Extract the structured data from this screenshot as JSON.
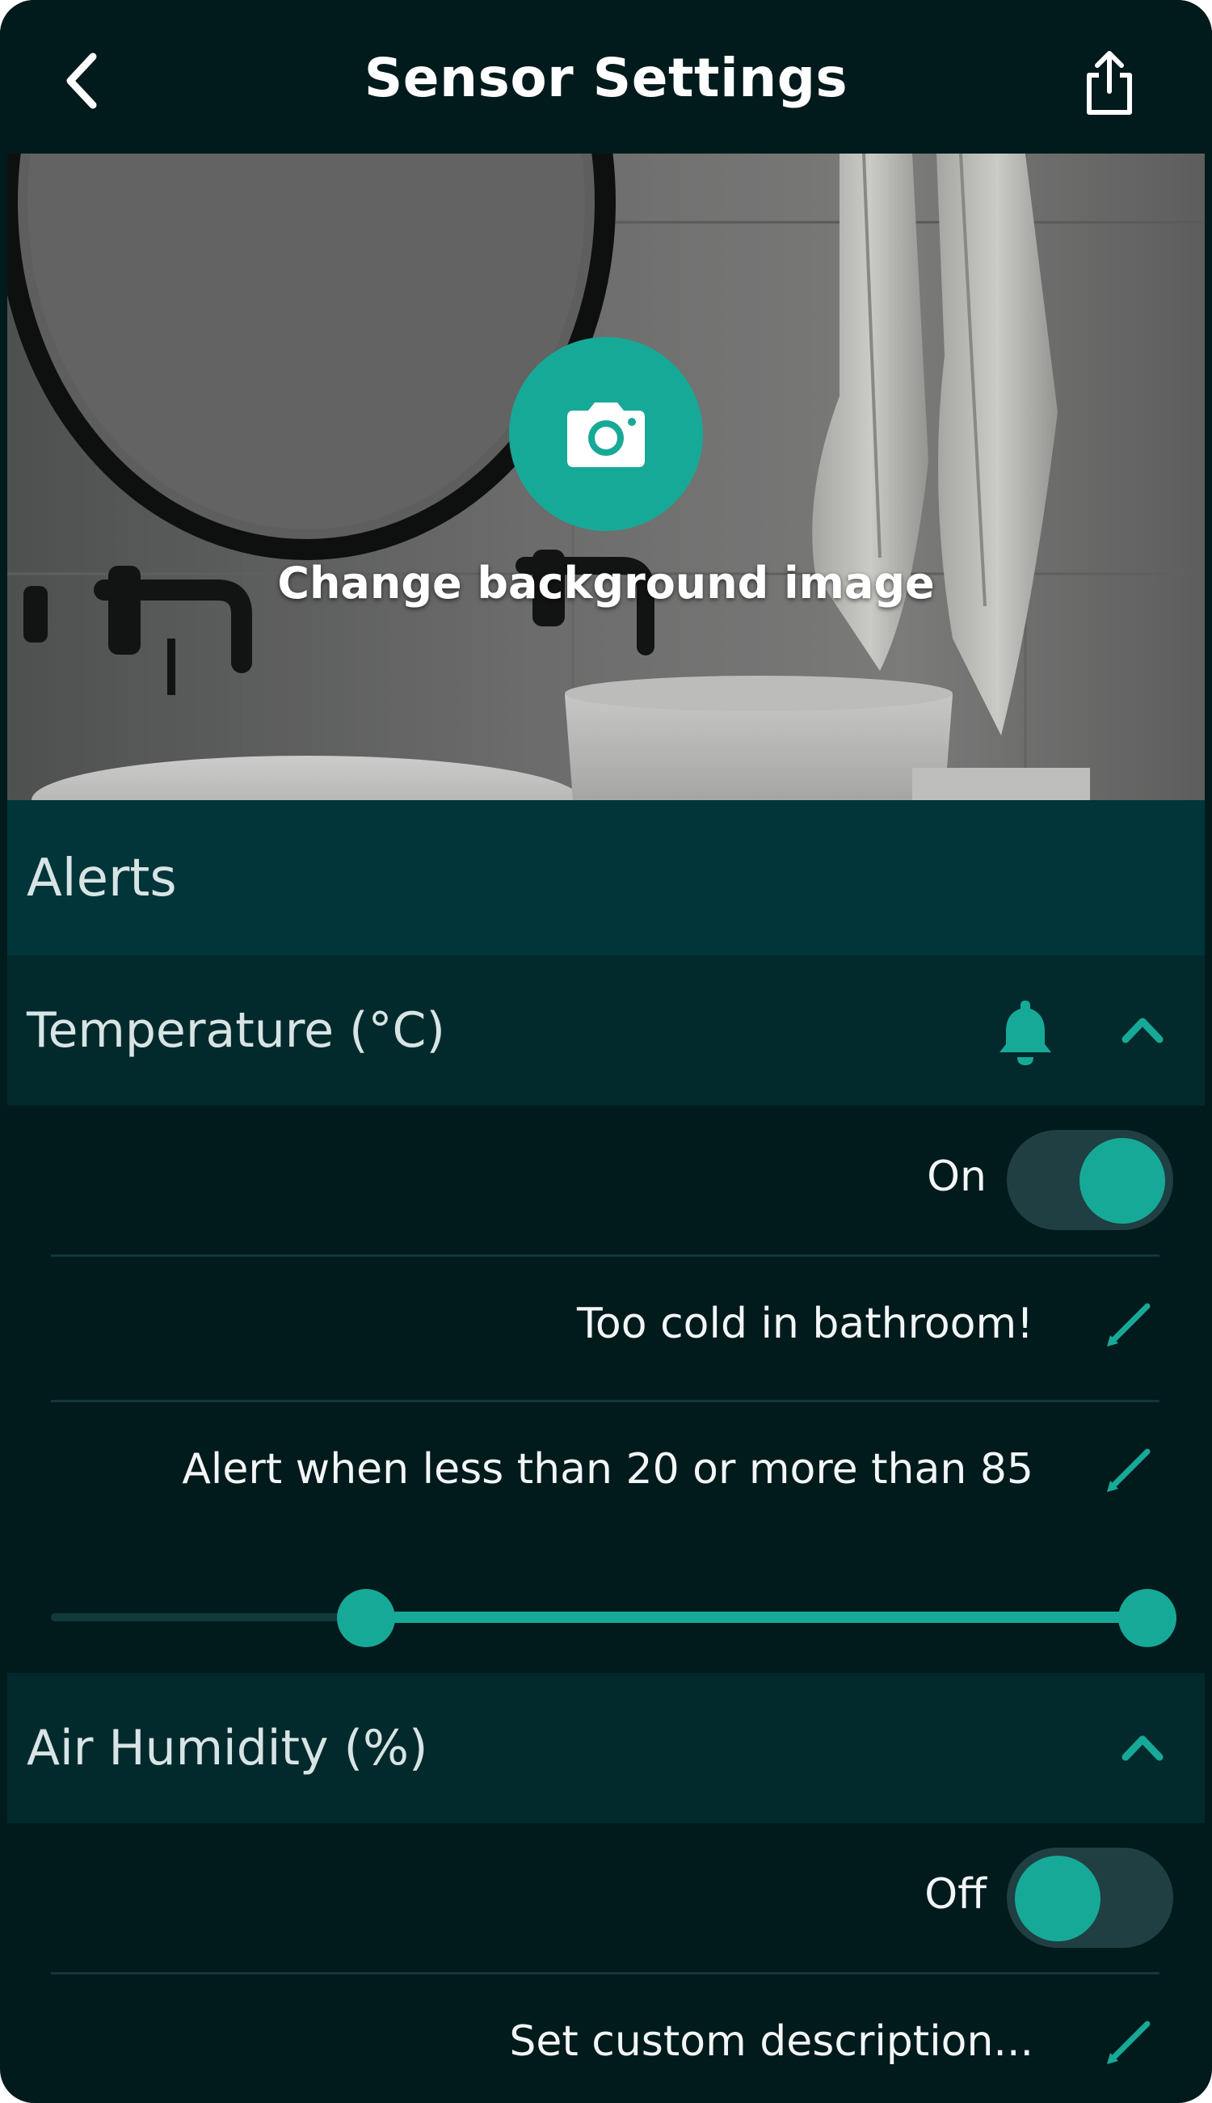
{
  "header": {
    "title": "Sensor Settings",
    "back_icon": "chevron-left-icon",
    "share_icon": "share-icon"
  },
  "hero": {
    "change_label": "Change background image",
    "camera_icon": "camera-icon"
  },
  "alerts": {
    "title": "Alerts"
  },
  "temperature": {
    "title": "Temperature (°C)",
    "bell_icon": "bell-icon",
    "expanded": true,
    "toggle_label": "On",
    "toggle_on": true,
    "description": "Too cold in bathroom!",
    "range_text": "Alert when less than 20 or more than 85",
    "range_low_fraction": 0.28,
    "range_high_fraction": 0.98
  },
  "humidity": {
    "title": "Air Humidity (%)",
    "expanded": true,
    "toggle_label": "Off",
    "toggle_on": false,
    "description": "Set custom description..."
  },
  "colors": {
    "background": "#011a1c",
    "accent": "#17a997",
    "section_header": "#022a2d",
    "alerts_bar": "#013539"
  }
}
